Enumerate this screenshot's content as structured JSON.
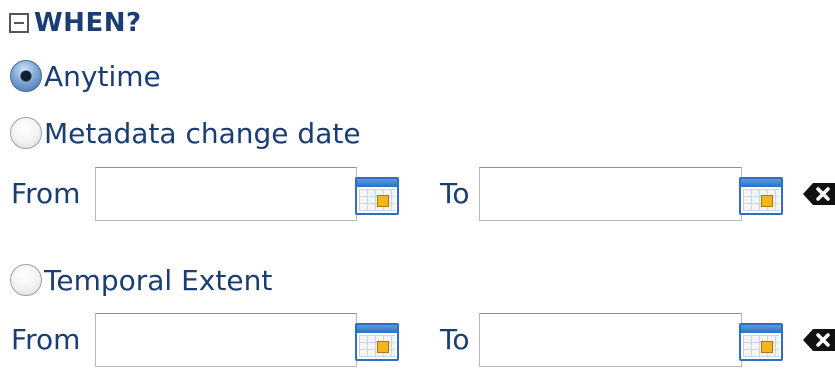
{
  "section": {
    "title": "WHEN?"
  },
  "options": {
    "anytime": {
      "label": "Anytime",
      "checked": true
    },
    "metadata_change_date": {
      "label": "Metadata change date",
      "checked": false
    },
    "temporal_extent": {
      "label": "Temporal Extent",
      "checked": false
    }
  },
  "metadata_range": {
    "from_label": "From",
    "from_value": "",
    "to_label": "To",
    "to_value": ""
  },
  "temporal_range": {
    "from_label": "From",
    "from_value": "",
    "to_label": "To",
    "to_value": ""
  },
  "icons": {
    "collapse": "minus-box-icon",
    "calendar": "calendar-icon",
    "clear": "clear-backspace-icon"
  },
  "colors": {
    "label_text": "#1a3e74",
    "calendar_border": "#2f6fc0",
    "calendar_mark": "#f2b61b"
  }
}
